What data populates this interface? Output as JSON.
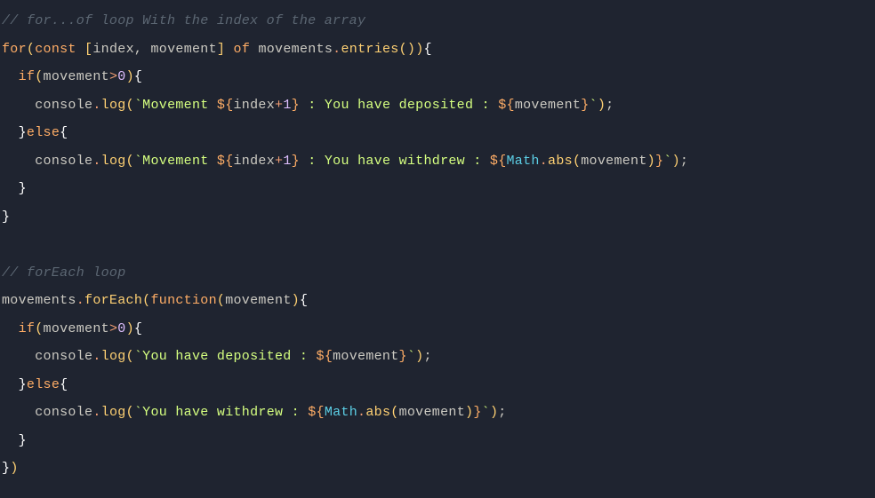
{
  "code": {
    "l1_comment": "// for...of loop With the index of the array",
    "l2_for": "for",
    "l2_const": "const",
    "l2_index": "index",
    "l2_movement": "movement",
    "l2_of": "of",
    "l2_movements": "movements",
    "l2_entries": "entries",
    "l3_if": "if",
    "l3_movement": "movement",
    "l3_zero": "0",
    "l4_console": "console",
    "l4_log": "log",
    "l4_str1": "`Movement ",
    "l4_interp1_var": "index",
    "l4_interp1_num": "1",
    "l4_str2": " : You have deposited : ",
    "l4_interp2_var": "movement",
    "l4_str3": "`",
    "l5_else": "else",
    "l6_console": "console",
    "l6_log": "log",
    "l6_str1": "`Movement ",
    "l6_interp1_var": "index",
    "l6_interp1_num": "1",
    "l6_str2": " : You have withdrew : ",
    "l6_math": "Math",
    "l6_abs": "abs",
    "l6_interp2_var": "movement",
    "l6_str3": "`",
    "l9_comment": "// forEach loop",
    "l10_movements": "movements",
    "l10_forEach": "forEach",
    "l10_function": "function",
    "l10_param": "movement",
    "l11_if": "if",
    "l11_movement": "movement",
    "l11_zero": "0",
    "l12_console": "console",
    "l12_log": "log",
    "l12_str1": "`You have deposited : ",
    "l12_interp_var": "movement",
    "l12_str2": "`",
    "l13_else": "else",
    "l14_console": "console",
    "l14_log": "log",
    "l14_str1": "`You have withdrew : ",
    "l14_math": "Math",
    "l14_abs": "abs",
    "l14_interp_var": "movement",
    "l14_str2": "`"
  }
}
